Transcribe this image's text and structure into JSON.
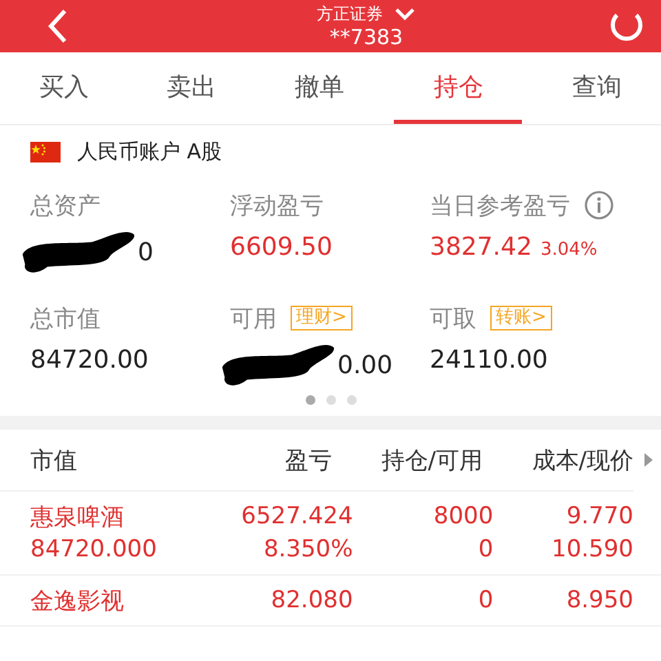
{
  "header": {
    "title": "方正证券",
    "account": "**7383"
  },
  "tabs": [
    {
      "label": "买入",
      "selected": false
    },
    {
      "label": "卖出",
      "selected": false
    },
    {
      "label": "撤单",
      "selected": false
    },
    {
      "label": "持仓",
      "selected": true
    },
    {
      "label": "查询",
      "selected": false
    }
  ],
  "account_type": "人民币账户 A股",
  "summary": [
    {
      "label": "总资产",
      "value": "0",
      "redacted": true,
      "kind": "plain"
    },
    {
      "label": "浮动盈亏",
      "value": "6609.50",
      "kind": "profit"
    },
    {
      "label": "当日参考盈亏",
      "value": "3827.42",
      "extra": "3.04%",
      "info": true,
      "kind": "profit"
    },
    {
      "label": "总市值",
      "value": "84720.00",
      "kind": "plain"
    },
    {
      "label": "可用",
      "tag": "理财>",
      "value": "0.00",
      "redacted": true,
      "kind": "plain"
    },
    {
      "label": "可取",
      "tag": "转账>",
      "value": "24110.00",
      "kind": "plain"
    }
  ],
  "pager": [
    {
      "selected": true
    },
    {
      "selected": false
    },
    {
      "selected": false
    }
  ],
  "table": {
    "columns": [
      "市值",
      "盈亏",
      "持仓/可用",
      "成本/现价"
    ],
    "rows": [
      {
        "lines": [
          [
            "惠泉啤酒",
            "6527.424",
            "8000",
            "9.770"
          ],
          [
            "84720.000",
            "8.350%",
            "0",
            "10.590"
          ]
        ]
      },
      {
        "lines": [
          [
            "金逸影视",
            "82.080",
            "0",
            "8.950"
          ]
        ]
      }
    ]
  }
}
